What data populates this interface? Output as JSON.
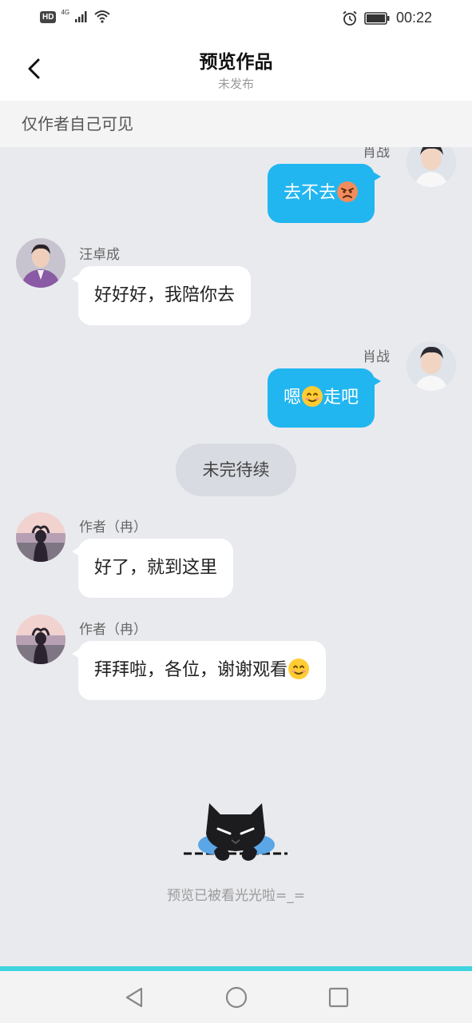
{
  "status_bar": {
    "left_badge": "HD",
    "network": "4G",
    "time": "00:22"
  },
  "nav": {
    "title": "预览作品",
    "subtitle": "未发布"
  },
  "banner": {
    "text": "仅作者自己可见"
  },
  "messages": [
    {
      "side": "right",
      "sender": "肖战",
      "text": "去不去",
      "emoji": "angry-face-icon"
    },
    {
      "side": "left",
      "sender": "汪卓成",
      "text": "好好好，我陪你去"
    },
    {
      "side": "right",
      "sender": "肖战",
      "text_before": "嗯",
      "emoji": "smiling-face-icon",
      "text_after": "走吧"
    },
    {
      "side": "left",
      "sender": "作者（冉）",
      "text": "好了，就到这里"
    },
    {
      "side": "left",
      "sender": "作者（冉）",
      "text": "拜拜啦，各位，谢谢观看",
      "emoji": "smiling-face-icon"
    }
  ],
  "divider": {
    "text": "未完待续"
  },
  "end": {
    "caption": "预览已被看光光啦=_="
  },
  "colors": {
    "accent": "#21b6f0",
    "background": "#e9eaee",
    "accent_line": "#3fd4e0"
  }
}
